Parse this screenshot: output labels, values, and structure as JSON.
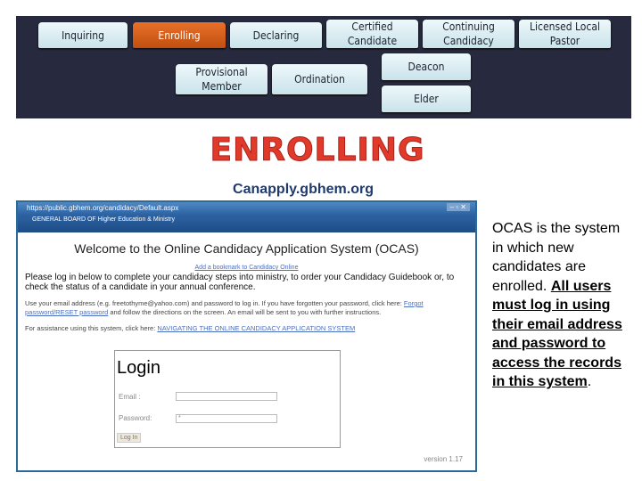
{
  "nav": {
    "top": [
      {
        "label": "Inquiring",
        "active": false
      },
      {
        "label": "Enrolling",
        "active": true
      },
      {
        "label": "Declaring",
        "active": false
      },
      {
        "label": "Certified Candidate",
        "active": false
      },
      {
        "label": "Continuing Candidacy",
        "active": false
      },
      {
        "label": "Licensed Local Pastor",
        "active": false
      }
    ],
    "bottom": [
      {
        "label": "Provisional Member"
      },
      {
        "label": "Ordination"
      },
      {
        "label": "Deacon"
      },
      {
        "label": "Elder"
      }
    ]
  },
  "title": "ENROLLING",
  "subtitle": "Canapply.gbhem.org",
  "screenshot": {
    "url": "https://public.gbhem.org/candidacy/Default.aspx",
    "window_controls": "– ▫ ✕",
    "org": "GENERAL BOARD OF Higher Education & Ministry",
    "welcome": "Welcome to the Online Candidacy Application System (OCAS)",
    "bookmark_link": "Add a bookmark to Candidacy Online",
    "intro": "Please log in below to complete your candidacy steps into ministry, to order your Candidacy Guidebook or, to check the status of a candidate in your annual conference.",
    "instructions_pre": "Use your email address (e.g. freetothyme@yahoo.com) and password to log in. If you have forgotten your password, click here: ",
    "forgot_link": "Forgot password/RESET password",
    "instructions_post": " and follow the directions on the screen. An email will be sent to you with further instructions.",
    "assist_pre": "For assistance using this system, click here: ",
    "assist_link": "NAVIGATING THE ONLINE CANDIDACY APPLICATION SYSTEM",
    "login_title": "Login",
    "email_label": "Email :",
    "email_value": "",
    "password_label": "Password:",
    "password_value": "*",
    "login_button": "Log In",
    "version": "version 1.17"
  },
  "side": {
    "t1": "OCAS is the system in which new candidates are enrolled. ",
    "t2": "All users must log in using their email address and password to access the records in this system",
    "t3": "."
  },
  "colors": {
    "nav_bg": "#272a3e",
    "active": "#d9601e",
    "title": "#e03a2a"
  }
}
